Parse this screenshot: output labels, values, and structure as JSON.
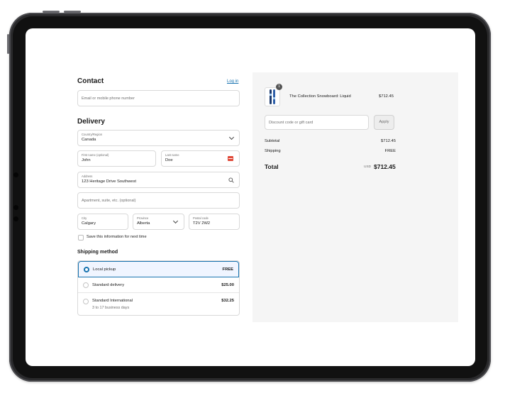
{
  "contact": {
    "heading": "Contact",
    "login_link": "Log in",
    "email_placeholder": "Email or mobile phone number"
  },
  "delivery": {
    "heading": "Delivery",
    "country_label": "Country/Region",
    "country_value": "Canada",
    "first_name_label": "First name (optional)",
    "first_name_value": "John",
    "last_name_label": "Last name",
    "last_name_value": "Doe",
    "address_label": "Address",
    "address_value": "123 Heritage Drive Southwest",
    "apartment_placeholder": "Apartment, suite, etc. (optional)",
    "city_label": "City",
    "city_value": "Calgary",
    "province_label": "Province",
    "province_value": "Alberta",
    "postal_label": "Postal code",
    "postal_value": "T2V 2W2",
    "save_info_label": "Save this information for next time",
    "save_info_checked": false
  },
  "shipping": {
    "heading": "Shipping method",
    "options": [
      {
        "name": "Local pickup",
        "sub": "",
        "price": "FREE",
        "selected": true
      },
      {
        "name": "Standard delivery",
        "sub": "",
        "price": "$25.00",
        "selected": false
      },
      {
        "name": "Standard International",
        "sub": "3 to 17 business days",
        "price": "$32.25",
        "selected": false
      }
    ]
  },
  "summary": {
    "product_name": "The Collection Snowboard: Liquid",
    "product_price": "$712.45",
    "product_qty": "1",
    "discount_placeholder": "Discount code or gift card",
    "apply_label": "Apply",
    "subtotal_label": "Subtotal",
    "subtotal_value": "$712.45",
    "shipping_label": "Shipping",
    "shipping_value": "FREE",
    "total_label": "Total",
    "total_currency": "USD",
    "total_value": "$712.45"
  },
  "colors": {
    "accent": "#1773b0",
    "summary_bg": "#f5f5f5",
    "device_frame": "#2a2a2c"
  }
}
